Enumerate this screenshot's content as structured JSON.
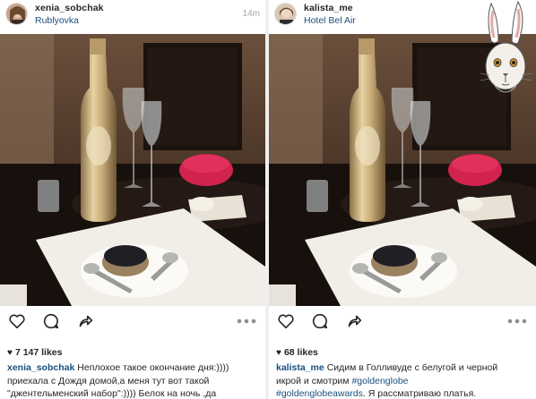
{
  "posts": [
    {
      "username": "xenia_sobchak",
      "location": "Rublyovka",
      "timestamp": "14m",
      "likes_count": "7 147 likes",
      "caption_user": "xenia_sobchak",
      "caption_text_1": "Неплохое такое окончание дня:))))",
      "caption_text_2": "приехала с Дождя домой,а меня тут вот такой",
      "caption_text_3": "\"джентельменский набор\":)))) Белок на ночь ,да"
    },
    {
      "username": "kalista_me",
      "location": "Hotel Bel Air",
      "likes_count": "68 likes",
      "caption_user": "kalista_me",
      "caption_text_1": "Сидим в Голливуде с белугой и черной",
      "caption_text_2": "икрой и смотрим",
      "caption_tag_1": "#goldenglobe",
      "caption_tag_2": "#goldenglobeawards",
      "caption_text_3": ". Я рассматриваю платья."
    }
  ],
  "icons": {
    "like": "heart-outline-icon",
    "comment": "comment-bubble-icon",
    "share": "share-arrow-icon",
    "more": "more-dots-icon",
    "likes_heart": "♥"
  },
  "colors": {
    "link": "#1c4f7d",
    "text": "#262626",
    "muted": "#a8a8a8"
  }
}
